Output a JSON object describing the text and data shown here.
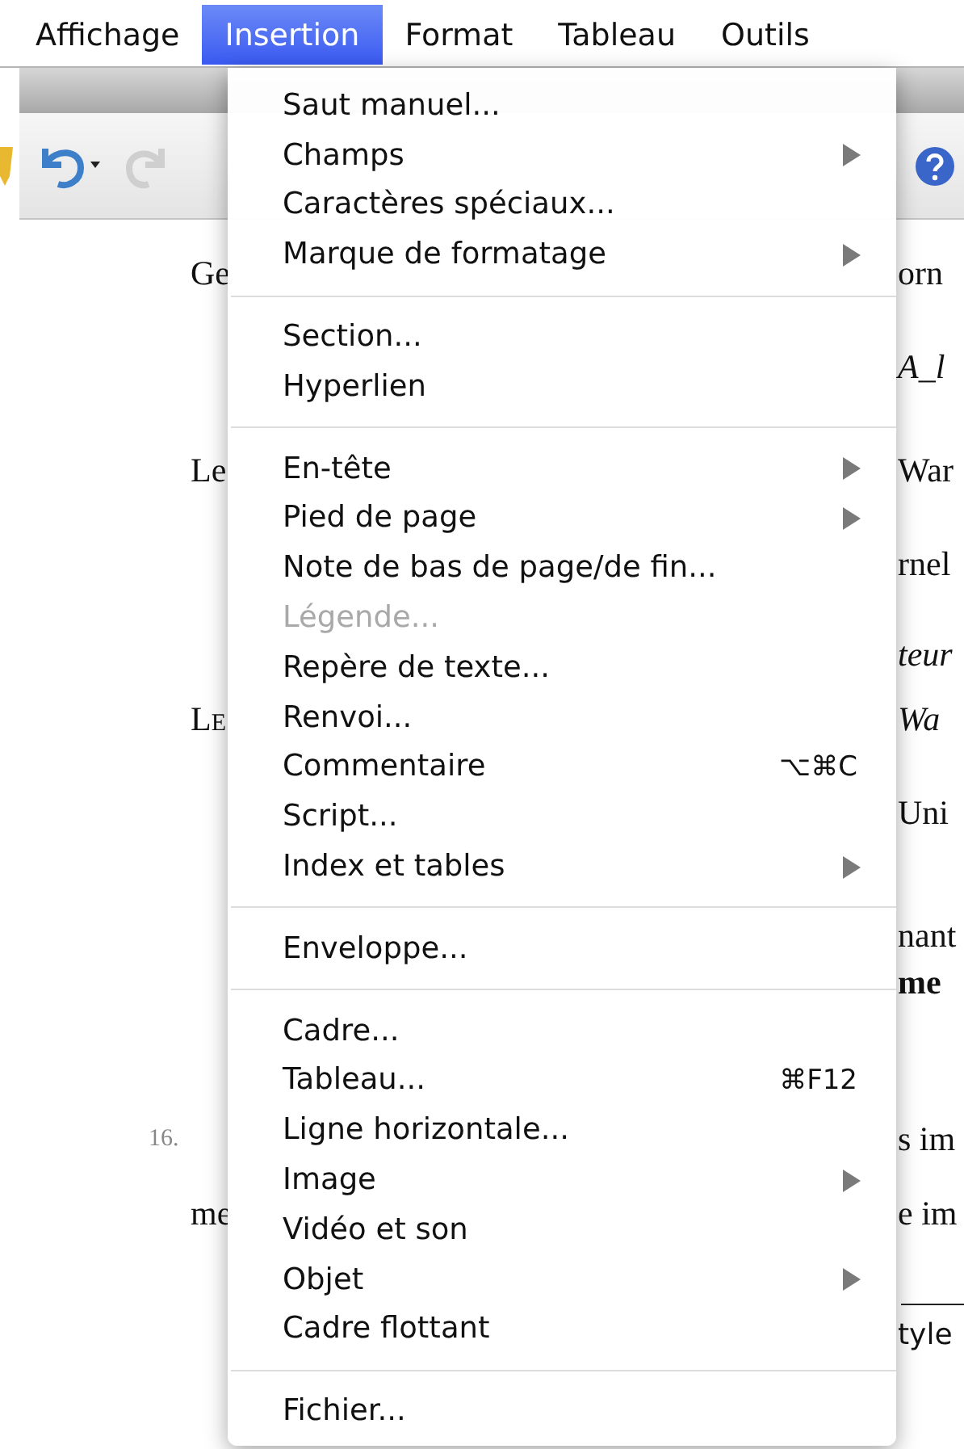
{
  "menubar": [
    {
      "label": "Affichage",
      "selected": false
    },
    {
      "label": "Insertion",
      "selected": true
    },
    {
      "label": "Format",
      "selected": false
    },
    {
      "label": "Tableau",
      "selected": false
    },
    {
      "label": "Outils",
      "selected": false
    }
  ],
  "menu": {
    "items": [
      {
        "kind": "item",
        "label": "Saut manuel...",
        "disabled": false,
        "submenu": false
      },
      {
        "kind": "item",
        "label": "Champs",
        "disabled": false,
        "submenu": true
      },
      {
        "kind": "item",
        "label": "Caractères spéciaux...",
        "disabled": false,
        "submenu": false
      },
      {
        "kind": "item",
        "label": "Marque de formatage",
        "disabled": false,
        "submenu": true
      },
      {
        "kind": "separator"
      },
      {
        "kind": "item",
        "label": "Section...",
        "disabled": false,
        "submenu": false
      },
      {
        "kind": "item",
        "label": "Hyperlien",
        "disabled": false,
        "submenu": false
      },
      {
        "kind": "separator"
      },
      {
        "kind": "item",
        "label": "En-tête",
        "disabled": false,
        "submenu": true
      },
      {
        "kind": "item",
        "label": "Pied de page",
        "disabled": false,
        "submenu": true
      },
      {
        "kind": "item",
        "label": "Note de bas de page/de fin...",
        "disabled": false,
        "submenu": false
      },
      {
        "kind": "item",
        "label": "Légende...",
        "disabled": true,
        "submenu": false
      },
      {
        "kind": "item",
        "label": "Repère de texte...",
        "disabled": false,
        "submenu": false
      },
      {
        "kind": "item",
        "label": "Renvoi...",
        "disabled": false,
        "submenu": false
      },
      {
        "kind": "item",
        "label": "Commentaire",
        "disabled": false,
        "submenu": false,
        "shortcut": "⌥⌘C"
      },
      {
        "kind": "item",
        "label": "Script...",
        "disabled": false,
        "submenu": false
      },
      {
        "kind": "item",
        "label": "Index et tables",
        "disabled": false,
        "submenu": true
      },
      {
        "kind": "separator"
      },
      {
        "kind": "item",
        "label": "Enveloppe...",
        "disabled": false,
        "submenu": false
      },
      {
        "kind": "separator"
      },
      {
        "kind": "item",
        "label": "Cadre...",
        "disabled": false,
        "submenu": false
      },
      {
        "kind": "item",
        "label": "Tableau...",
        "disabled": false,
        "submenu": false,
        "shortcut": "⌘F12"
      },
      {
        "kind": "item",
        "label": "Ligne horizontale...",
        "disabled": false,
        "submenu": false
      },
      {
        "kind": "item",
        "label": "Image",
        "disabled": false,
        "submenu": true
      },
      {
        "kind": "item",
        "label": "Vidéo et son",
        "disabled": false,
        "submenu": false
      },
      {
        "kind": "item",
        "label": "Objet",
        "disabled": false,
        "submenu": true
      },
      {
        "kind": "item",
        "label": "Cadre flottant",
        "disabled": false,
        "submenu": false
      },
      {
        "kind": "separator"
      },
      {
        "kind": "item",
        "label": "Fichier...",
        "disabled": false,
        "submenu": false
      }
    ]
  },
  "document": {
    "left": [
      {
        "text": "Ge",
        "kind": "roman"
      },
      {
        "text": "Le",
        "kind": "roman"
      },
      {
        "text": "Le",
        "kind": "smallcaps"
      },
      {
        "text": "16.",
        "kind": "number"
      },
      {
        "text": "me",
        "kind": "roman"
      }
    ],
    "right": [
      {
        "text": "orn",
        "kind": "roman"
      },
      {
        "text": "A_l",
        "kind": "italic"
      },
      {
        "text": "War",
        "kind": "roman"
      },
      {
        "text": "rnel",
        "kind": "roman"
      },
      {
        "text": "teur",
        "kind": "italic"
      },
      {
        "text": "Wa",
        "kind": "italic"
      },
      {
        "text": "Uni",
        "kind": "roman"
      },
      {
        "text": "nant",
        "kind": "roman"
      },
      {
        "text": "me",
        "kind": "bold"
      },
      {
        "text": "s im",
        "kind": "roman"
      },
      {
        "text": "e im",
        "kind": "roman"
      },
      {
        "text": "tyle",
        "kind": "sans"
      }
    ]
  }
}
